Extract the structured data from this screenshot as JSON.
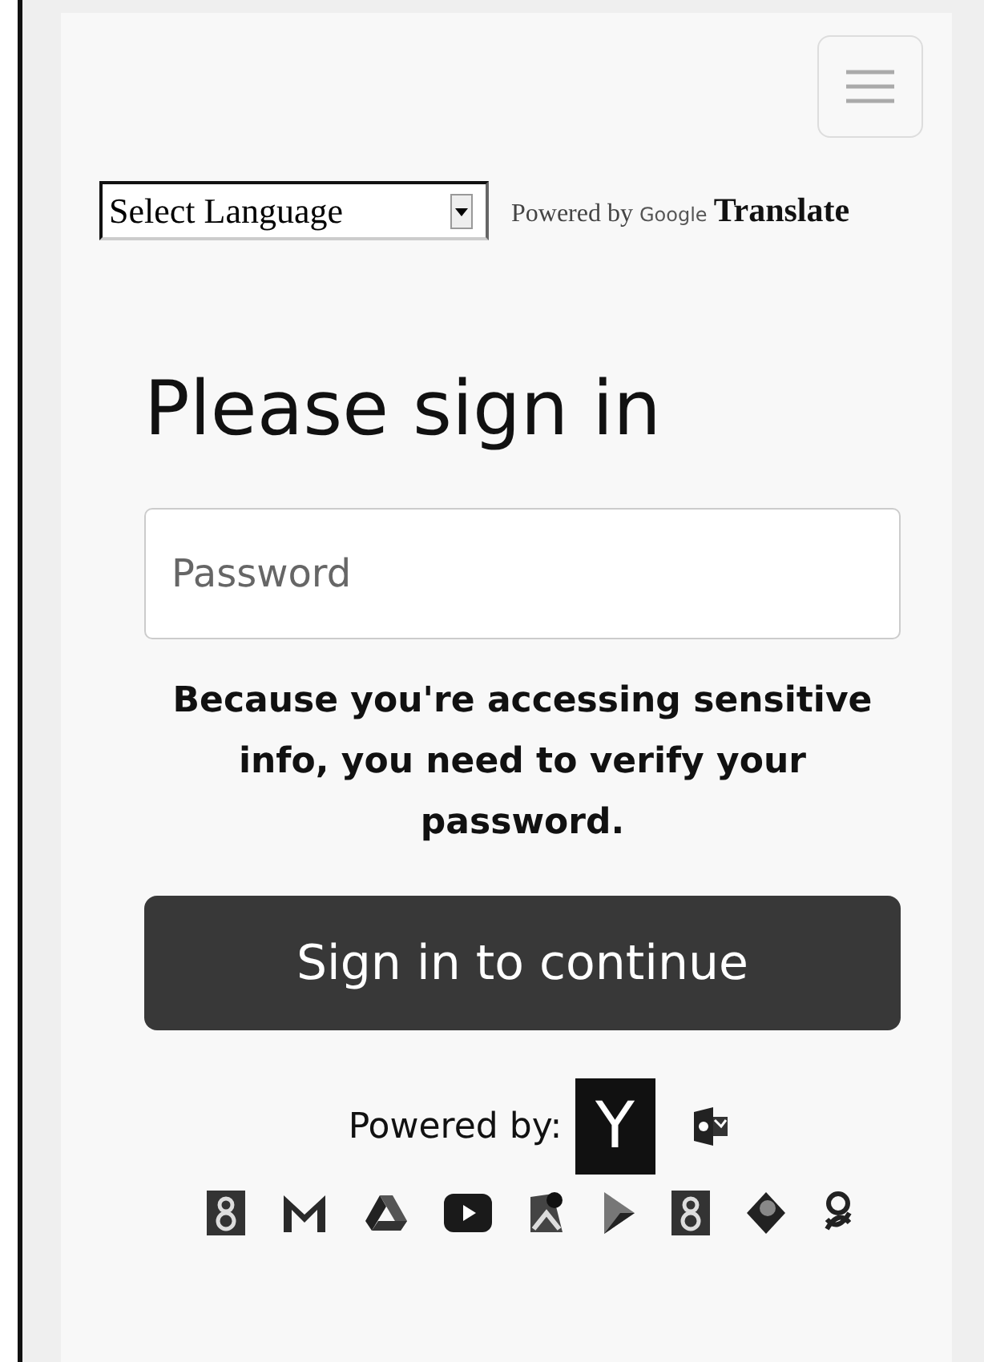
{
  "language_select": {
    "value": "Select Language"
  },
  "translate_attribution": {
    "prefix": "Powered by",
    "brand": "Google",
    "product": "Translate"
  },
  "heading": "Please sign in",
  "password_field": {
    "placeholder": "Password"
  },
  "notice": "Because you're accessing sensitive info, you need to verify your password.",
  "submit_button": "Sign in to continue",
  "powered_by": {
    "label": "Powered by:",
    "logo_letter": "Y"
  },
  "service_icons": [
    {
      "kind": "outlook"
    },
    {
      "kind": "google-tile"
    },
    {
      "kind": "mail"
    },
    {
      "kind": "drive"
    },
    {
      "kind": "video"
    },
    {
      "kind": "maps"
    },
    {
      "kind": "play"
    },
    {
      "kind": "plus-tile"
    },
    {
      "kind": "drop"
    },
    {
      "kind": "knot"
    }
  ]
}
